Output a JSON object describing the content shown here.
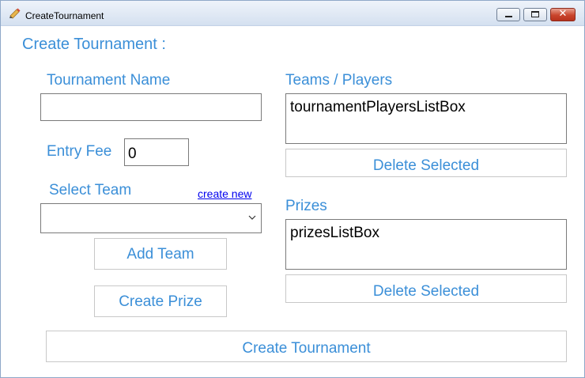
{
  "window": {
    "title": "CreateTournament"
  },
  "header": {
    "title": "Create Tournament :"
  },
  "tournament_name": {
    "label": "Tournament Name",
    "value": ""
  },
  "entry_fee": {
    "label": "Entry Fee",
    "value": "0"
  },
  "select_team": {
    "label": "Select Team",
    "create_new_link": "create new",
    "selected": ""
  },
  "buttons": {
    "add_team": "Add Team",
    "create_prize": "Create Prize",
    "delete_players": "Delete Selected",
    "delete_prizes": "Delete Selected",
    "create_tournament": "Create Tournament"
  },
  "teams_players": {
    "label": "Teams / Players",
    "list_text": "tournamentPlayersListBox"
  },
  "prizes": {
    "label": "Prizes",
    "list_text": "prizesListBox"
  },
  "colors": {
    "label_blue": "#3b8fd8",
    "link_blue": "#0000ee"
  }
}
